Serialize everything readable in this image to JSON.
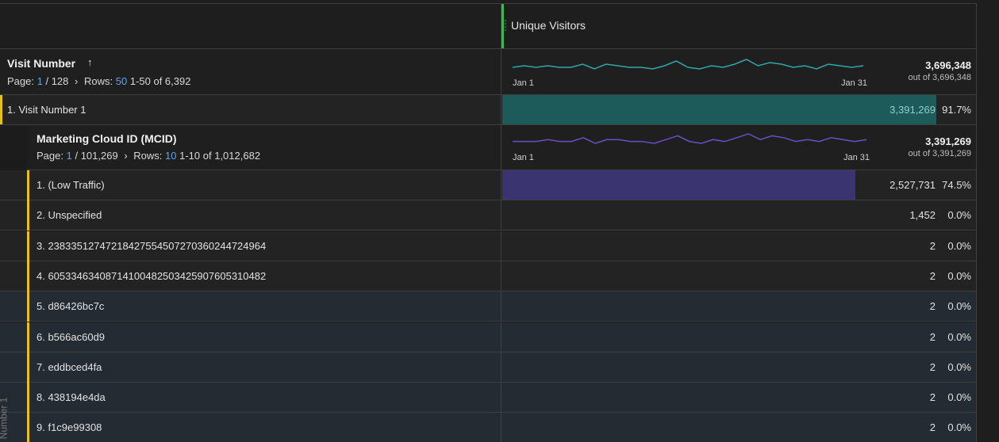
{
  "column": {
    "title": "Unique Visitors"
  },
  "dim1": {
    "title": "Visit Number",
    "sort_icon": "sort-ascending-icon",
    "page_label": "Page:",
    "page_current": "1",
    "page_total": "/ 128",
    "rows_label": "Rows:",
    "rows_value": "50",
    "range": "1-50 of 6,392",
    "spark_start": "Jan 1",
    "spark_end": "Jan 31",
    "total": "3,696,348",
    "out_of": "out of 3,696,348",
    "spark_color": "#2fa8a8",
    "spark_points": [
      40,
      41,
      40,
      41,
      40,
      40,
      42,
      39,
      42,
      41,
      40,
      40,
      39,
      41,
      44,
      40,
      39,
      41,
      40,
      42,
      45,
      41,
      43,
      42,
      40,
      41,
      39,
      42,
      41,
      40,
      41
    ]
  },
  "row1": {
    "label": "1.  Visit Number 1",
    "value": "3,391,269",
    "pct": "91.7%",
    "fraction": 0.917,
    "bar_color": "#1d5a5a"
  },
  "dim2": {
    "title": "Marketing Cloud ID (MCID)",
    "page_label": "Page:",
    "page_current": "1",
    "page_total": "/ 101,269",
    "rows_label": "Rows:",
    "rows_value": "10",
    "range": "1-10 of 1,012,682",
    "spark_start": "Jan 1",
    "spark_end": "Jan 31",
    "total": "3,391,269",
    "out_of": "out of 3,391,269",
    "spark_color": "#6a4fc4",
    "spark_points": [
      40,
      40,
      40,
      41,
      40,
      40,
      42,
      39,
      41,
      41,
      40,
      40,
      39,
      41,
      43,
      40,
      39,
      41,
      40,
      42,
      44,
      41,
      43,
      42,
      40,
      41,
      40,
      42,
      41,
      40,
      41
    ]
  },
  "rows": [
    {
      "label": "1.  (Low Traffic)",
      "value": "2,527,731",
      "pct": "74.5%",
      "fraction": 0.745
    },
    {
      "label": "2.  Unspecified",
      "value": "1,452",
      "pct": "0.0%",
      "fraction": 0.0
    },
    {
      "label": "3.  23833512747218427554507270360244724964",
      "value": "2",
      "pct": "0.0%",
      "fraction": 0.0
    },
    {
      "label": "4.  60533463408714100482503425907605310482",
      "value": "2",
      "pct": "0.0%",
      "fraction": 0.0
    },
    {
      "label": "5.  d86426bc7c",
      "value": "2",
      "pct": "0.0%",
      "fraction": 0.0
    },
    {
      "label": "6.  b566ac60d9",
      "value": "2",
      "pct": "0.0%",
      "fraction": 0.0
    },
    {
      "label": "7.  eddbced4fa",
      "value": "2",
      "pct": "0.0%",
      "fraction": 0.0
    },
    {
      "label": "8.  438194e4da",
      "value": "2",
      "pct": "0.0%",
      "fraction": 0.0
    },
    {
      "label": "9.  f1c9e99308",
      "value": "2",
      "pct": "0.0%",
      "fraction": 0.0
    }
  ],
  "row_bar_color": "#3a3470",
  "side_label": "Number 1"
}
